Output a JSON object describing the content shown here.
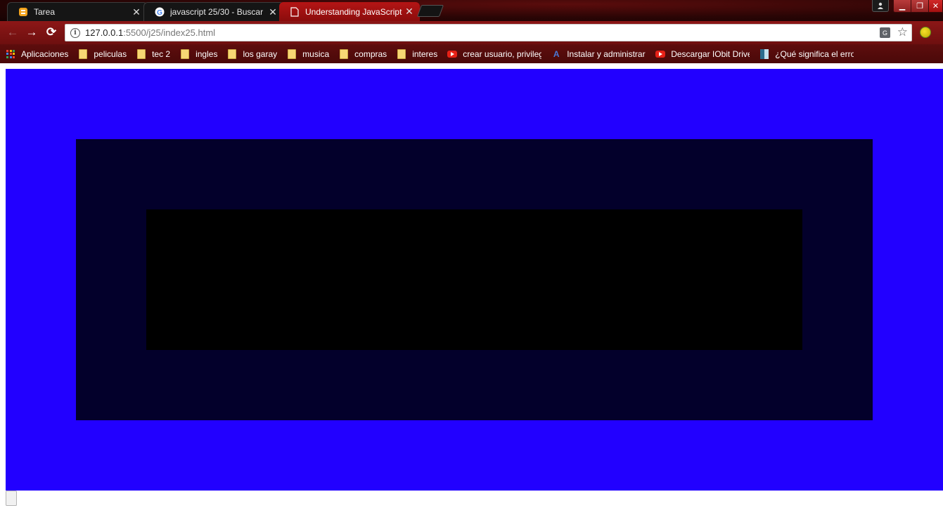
{
  "tabs": [
    {
      "title": "Tarea",
      "icon": "blogger-icon",
      "active": false
    },
    {
      "title": "javascript 25/30 - Buscar",
      "icon": "google-icon",
      "active": false
    },
    {
      "title": "Understanding JavaScript",
      "icon": "document-icon",
      "active": true
    }
  ],
  "toolbar": {
    "url_host": "127.0.0.1",
    "url_rest": ":5500/j25/index25.html"
  },
  "bookmarks": [
    {
      "label": "Aplicaciones",
      "icon": "apps-icon"
    },
    {
      "label": "peliculas",
      "icon": "folder-icon"
    },
    {
      "label": "tec 2",
      "icon": "folder-icon"
    },
    {
      "label": "ingles",
      "icon": "folder-icon"
    },
    {
      "label": "los garay",
      "icon": "folder-icon"
    },
    {
      "label": "musica",
      "icon": "folder-icon"
    },
    {
      "label": "compras",
      "icon": "folder-icon"
    },
    {
      "label": "interes",
      "icon": "folder-icon"
    },
    {
      "label": "crear usuario, privileg",
      "icon": "youtube-icon"
    },
    {
      "label": "Instalar y administrar",
      "icon": "letter-a-icon"
    },
    {
      "label": "Descargar IObit Drive",
      "icon": "youtube-icon"
    },
    {
      "label": "¿Qué significa el error",
      "icon": "document-icon"
    }
  ],
  "colors": {
    "outer_box": "#2200ff",
    "middle_box": "#03002b",
    "inner_box": "#000000",
    "theme_red": "#8c1717"
  }
}
